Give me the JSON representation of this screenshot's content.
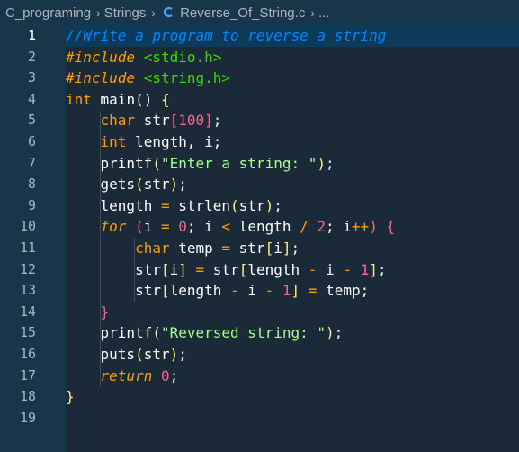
{
  "breadcrumb": {
    "folder1": "C_programing",
    "folder2": "Strings",
    "file": "Reverse_Of_String.c",
    "ellipsis": "...",
    "file_icon": "C"
  },
  "editor": {
    "line_numbers": [
      "1",
      "2",
      "3",
      "4",
      "5",
      "6",
      "7",
      "8",
      "9",
      "10",
      "11",
      "12",
      "13",
      "14",
      "15",
      "16",
      "17",
      "18",
      "19"
    ],
    "lines": [
      [
        {
          "t": "//Write a program to reverse a string",
          "c": "c-comment"
        }
      ],
      [
        {
          "t": "#include",
          "c": "c-kw"
        },
        {
          "t": " <stdio.h>",
          "c": "c-str"
        }
      ],
      [
        {
          "t": "#include",
          "c": "c-kw"
        },
        {
          "t": " <string.h>",
          "c": "c-str"
        }
      ],
      [
        {
          "t": "int",
          "c": "c-type"
        },
        {
          "t": " main",
          "c": "c-fn"
        },
        {
          "t": "()",
          "c": "c-sym"
        },
        {
          "t": " {",
          "c": "c-yellow"
        }
      ],
      [
        {
          "t": "    char",
          "c": "c-type"
        },
        {
          "t": " str",
          "c": "c-id"
        },
        {
          "t": "[",
          "c": "c-pink"
        },
        {
          "t": "100",
          "c": "c-num"
        },
        {
          "t": "]",
          "c": "c-pink"
        },
        {
          "t": ";",
          "c": "c-sym"
        }
      ],
      [
        {
          "t": "    int",
          "c": "c-type"
        },
        {
          "t": " length, i;",
          "c": "c-id"
        }
      ],
      [
        {
          "t": "    printf",
          "c": "c-fn"
        },
        {
          "t": "(",
          "c": "c-yellow"
        },
        {
          "t": "\"Enter a string: \"",
          "c": "c-strq"
        },
        {
          "t": ")",
          "c": "c-yellow"
        },
        {
          "t": ";",
          "c": "c-sym"
        }
      ],
      [
        {
          "t": "    gets",
          "c": "c-fn"
        },
        {
          "t": "(",
          "c": "c-yellow"
        },
        {
          "t": "str",
          "c": "c-id"
        },
        {
          "t": ")",
          "c": "c-yellow"
        },
        {
          "t": ";",
          "c": "c-sym"
        }
      ],
      [
        {
          "t": "    length ",
          "c": "c-id"
        },
        {
          "t": "=",
          "c": "c-op"
        },
        {
          "t": " strlen",
          "c": "c-fn"
        },
        {
          "t": "(",
          "c": "c-yellow"
        },
        {
          "t": "str",
          "c": "c-id"
        },
        {
          "t": ")",
          "c": "c-yellow"
        },
        {
          "t": ";",
          "c": "c-sym"
        }
      ],
      [
        {
          "t": "    for",
          "c": "c-kw"
        },
        {
          "t": " (",
          "c": "c-pink"
        },
        {
          "t": "i ",
          "c": "c-id"
        },
        {
          "t": "=",
          "c": "c-op"
        },
        {
          "t": " 0",
          "c": "c-num"
        },
        {
          "t": "; i ",
          "c": "c-id"
        },
        {
          "t": "<",
          "c": "c-op"
        },
        {
          "t": " length ",
          "c": "c-id"
        },
        {
          "t": "/",
          "c": "c-op"
        },
        {
          "t": " 2",
          "c": "c-num"
        },
        {
          "t": "; i",
          "c": "c-id"
        },
        {
          "t": "++",
          "c": "c-op"
        },
        {
          "t": ")",
          "c": "c-pink"
        },
        {
          "t": " {",
          "c": "c-pink"
        }
      ],
      [
        {
          "t": "        char",
          "c": "c-type"
        },
        {
          "t": " temp ",
          "c": "c-id"
        },
        {
          "t": "=",
          "c": "c-op"
        },
        {
          "t": " str",
          "c": "c-id"
        },
        {
          "t": "[",
          "c": "c-yellow"
        },
        {
          "t": "i",
          "c": "c-id"
        },
        {
          "t": "]",
          "c": "c-yellow"
        },
        {
          "t": ";",
          "c": "c-sym"
        }
      ],
      [
        {
          "t": "        str",
          "c": "c-id"
        },
        {
          "t": "[",
          "c": "c-yellow"
        },
        {
          "t": "i",
          "c": "c-id"
        },
        {
          "t": "]",
          "c": "c-yellow"
        },
        {
          "t": " ",
          "c": "c-id"
        },
        {
          "t": "=",
          "c": "c-op"
        },
        {
          "t": " str",
          "c": "c-id"
        },
        {
          "t": "[",
          "c": "c-yellow"
        },
        {
          "t": "length ",
          "c": "c-id"
        },
        {
          "t": "-",
          "c": "c-op"
        },
        {
          "t": " i ",
          "c": "c-id"
        },
        {
          "t": "-",
          "c": "c-op"
        },
        {
          "t": " 1",
          "c": "c-num"
        },
        {
          "t": "]",
          "c": "c-yellow"
        },
        {
          "t": ";",
          "c": "c-sym"
        }
      ],
      [
        {
          "t": "        str",
          "c": "c-id"
        },
        {
          "t": "[",
          "c": "c-yellow"
        },
        {
          "t": "length ",
          "c": "c-id"
        },
        {
          "t": "-",
          "c": "c-op"
        },
        {
          "t": " i ",
          "c": "c-id"
        },
        {
          "t": "-",
          "c": "c-op"
        },
        {
          "t": " 1",
          "c": "c-num"
        },
        {
          "t": "]",
          "c": "c-yellow"
        },
        {
          "t": " ",
          "c": "c-id"
        },
        {
          "t": "=",
          "c": "c-op"
        },
        {
          "t": " temp;",
          "c": "c-id"
        }
      ],
      [
        {
          "t": "    }",
          "c": "c-pink"
        }
      ],
      [
        {
          "t": "    printf",
          "c": "c-fn"
        },
        {
          "t": "(",
          "c": "c-yellow"
        },
        {
          "t": "\"Reversed string: \"",
          "c": "c-strq"
        },
        {
          "t": ")",
          "c": "c-yellow"
        },
        {
          "t": ";",
          "c": "c-sym"
        }
      ],
      [
        {
          "t": "    puts",
          "c": "c-fn"
        },
        {
          "t": "(",
          "c": "c-yellow"
        },
        {
          "t": "str",
          "c": "c-id"
        },
        {
          "t": ")",
          "c": "c-yellow"
        },
        {
          "t": ";",
          "c": "c-sym"
        }
      ],
      [
        {
          "t": "    return",
          "c": "c-kw"
        },
        {
          "t": " 0",
          "c": "c-num"
        },
        {
          "t": ";",
          "c": "c-sym"
        }
      ],
      [
        {
          "t": "}",
          "c": "c-yellow"
        }
      ],
      []
    ]
  },
  "colors": {
    "background": "#193549",
    "editor_bg": "#1b2a38",
    "current_line": "#0d3a58",
    "comment": "#0088ff",
    "keyword": "#ff9d00",
    "string": "#3ad900",
    "number": "#ff628c"
  }
}
